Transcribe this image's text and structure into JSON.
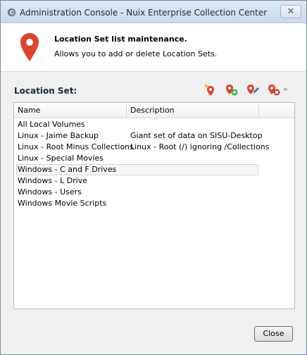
{
  "window": {
    "title": "Administration Console - Nuix Enterprise Collection Center",
    "close_glyph": "✕"
  },
  "header": {
    "title": "Location Set list maintenance.",
    "subtitle": "Allows you to add or delete Location Sets.",
    "icon": "map-pin-icon",
    "accent": "#d9452e"
  },
  "location_set": {
    "label": "Location Set:",
    "toolbar": [
      {
        "name": "new-location-set-icon"
      },
      {
        "name": "add-location-set-icon"
      },
      {
        "name": "edit-location-set-icon"
      },
      {
        "name": "delete-location-set-icon"
      }
    ],
    "more_glyph": "»"
  },
  "table": {
    "columns": [
      "Name",
      "Description"
    ],
    "rows": [
      {
        "name": "All Local Volumes",
        "description": ""
      },
      {
        "name": "Linux - Jaime Backup",
        "description": "Giant set of data on SISU-Desktop"
      },
      {
        "name": "Linux - Root Minus Collections",
        "description": "Linux - Root (/) ignoring /Collections"
      },
      {
        "name": "Linux - Special Movies",
        "description": ""
      },
      {
        "name": "Windows - C and F Drives",
        "description": "",
        "selected": true
      },
      {
        "name": "Windows - L Drive",
        "description": ""
      },
      {
        "name": "Windows - Users",
        "description": ""
      },
      {
        "name": "Windows Movie Scripts",
        "description": ""
      }
    ]
  },
  "footer": {
    "close_label": "Close"
  }
}
